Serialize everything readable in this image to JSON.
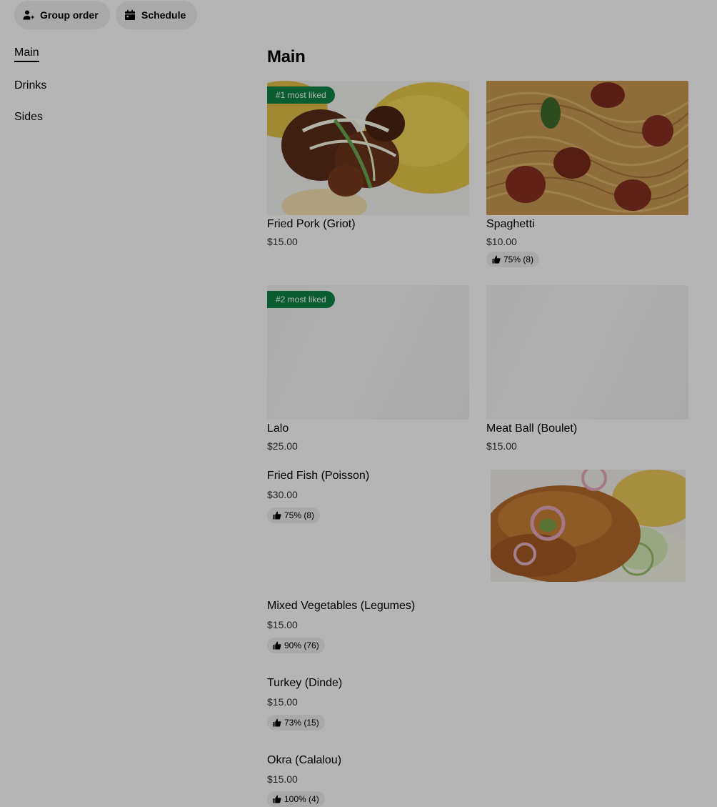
{
  "header": {
    "group_order_label": "Group order",
    "schedule_label": "Schedule"
  },
  "sidebar": {
    "items": [
      {
        "label": "Main",
        "active": true
      },
      {
        "label": "Drinks",
        "active": false
      },
      {
        "label": "Sides",
        "active": false
      }
    ]
  },
  "section": {
    "title": "Main",
    "items": [
      {
        "name": "Fried Pork (Griot)",
        "price": "$15.00",
        "badge": "#1 most liked",
        "image": "fried-pork-photo"
      },
      {
        "name": "Spaghetti",
        "price": "$10.00",
        "rating": "75% (8)",
        "image": "spaghetti-photo"
      },
      {
        "name": "Lalo",
        "price": "$25.00",
        "badge": "#2 most liked",
        "image": "placeholder"
      },
      {
        "name": "Meat Ball (Boulet)",
        "price": "$15.00",
        "image": "placeholder"
      },
      {
        "name": "Fried Fish (Poisson)",
        "price": "$30.00",
        "rating": "75% (8)",
        "image": "fried-fish-photo"
      },
      {
        "name": "Mixed Vegetables (Legumes)",
        "price": "$15.00",
        "rating": "90% (76)"
      },
      {
        "name": "Turkey (Dinde)",
        "price": "$15.00",
        "rating": "73% (15)"
      },
      {
        "name": "Okra (Calalou)",
        "price": "$15.00",
        "rating": "100% (4)"
      }
    ]
  },
  "colors": {
    "badge_green": "#0e8345",
    "pill_bg": "#eeeeee",
    "overlay": "rgba(0,0,0,0.29)"
  }
}
